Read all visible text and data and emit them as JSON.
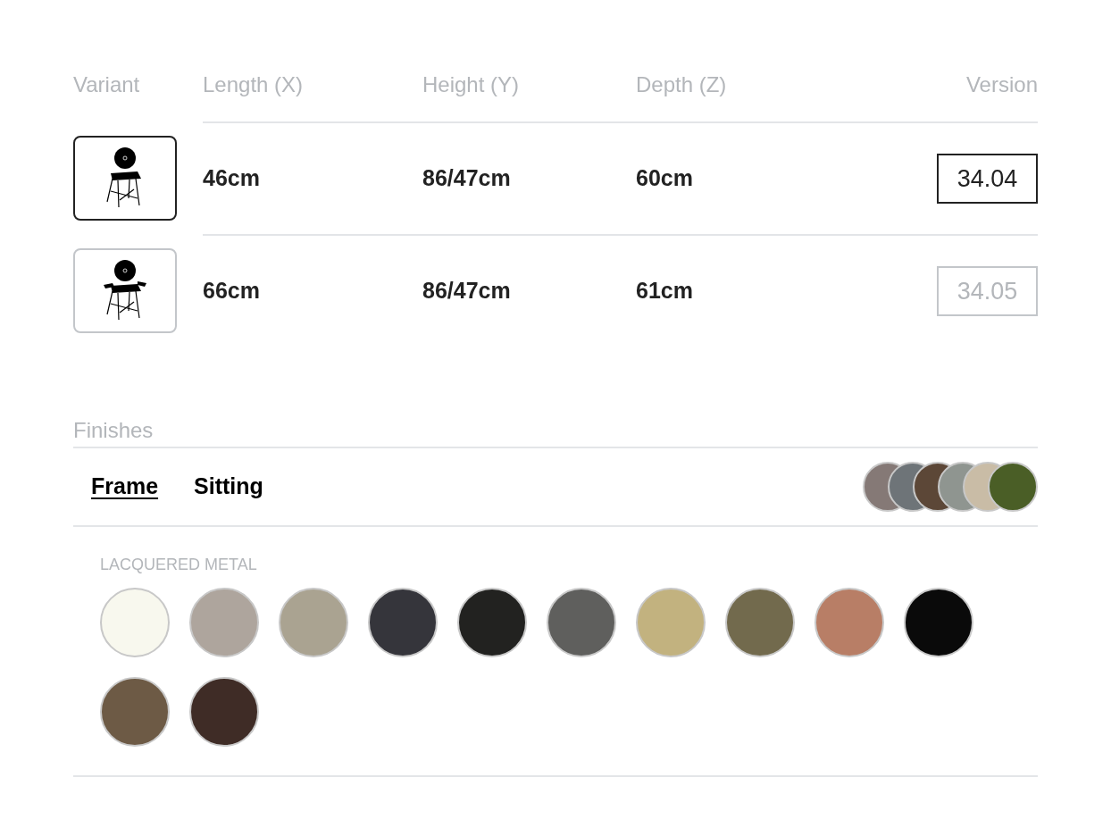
{
  "table": {
    "columns": [
      "Variant",
      "Length (X)",
      "Height (Y)",
      "Depth (Z)",
      "Version"
    ],
    "rows": [
      {
        "kind": "chair",
        "selected": true,
        "length": "46cm",
        "height": "86/47cm",
        "depth": "60cm",
        "version": "34.04"
      },
      {
        "kind": "armchair",
        "selected": false,
        "length": "66cm",
        "height": "86/47cm",
        "depth": "61cm",
        "version": "34.05"
      }
    ]
  },
  "finishes": {
    "title": "Finishes",
    "tabs": [
      {
        "label": "Frame",
        "selected": true
      },
      {
        "label": "Sitting",
        "selected": false
      }
    ],
    "preview_swatches": [
      {
        "color": "#857976"
      },
      {
        "color": "#6e7478"
      },
      {
        "color": "#5c4737"
      },
      {
        "color": "#8f9590"
      },
      {
        "color": "#c9bca6"
      },
      {
        "color": "#4a5e26"
      }
    ],
    "group_label": "LACQUERED METAL",
    "swatches": [
      {
        "color": "#f8f8ee"
      },
      {
        "color": "#aea59d"
      },
      {
        "color": "#aaa391"
      },
      {
        "color": "#35353b"
      },
      {
        "color": "#222220"
      },
      {
        "color": "#5f5f5d"
      },
      {
        "color": "#c2b27f"
      },
      {
        "color": "#726a4d"
      },
      {
        "color": "#b87e66"
      },
      {
        "color": "#0a0a0a"
      },
      {
        "color": "#6d5a45"
      },
      {
        "color": "#3f2c26"
      }
    ]
  }
}
